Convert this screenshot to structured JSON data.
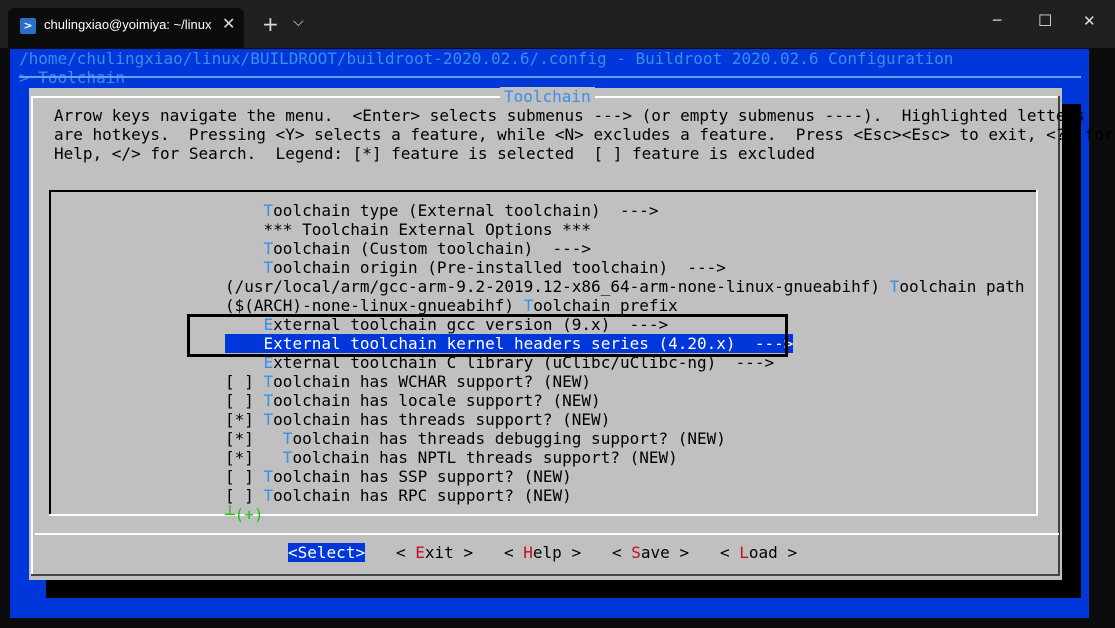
{
  "window": {
    "tab_title": "chulingxiao@yoimiya: ~/linux",
    "tab_icon": "terminal-icon",
    "new_tab": "+",
    "dropdown": "⌵",
    "minimize": "─",
    "maximize": "☐",
    "close": "✕",
    "tab_close": "✕"
  },
  "header": {
    "path": "/home/chulingxiao/linux/BUILDROOT/buildroot-2020.02.6/.config - Buildroot 2020.02.6 Configuration",
    "breadcrumb": "> Toolchain"
  },
  "dialog": {
    "title": "Toolchain",
    "help_lines": [
      "Arrow keys navigate the menu.  <Enter> selects submenus ---> (or empty submenus ----).  Highlighted letters",
      "are hotkeys.  Pressing <Y> selects a feature, while <N> excludes a feature.  Press <Esc><Esc> to exit, <?> for",
      "Help, </> for Search.  Legend: [*] feature is selected  [ ] feature is excluded"
    ]
  },
  "menu": {
    "items": [
      {
        "prefix": "    ",
        "hotkey": "T",
        "rest": "oolchain type (External toolchain)  --->"
      },
      {
        "prefix": "    ",
        "hotkey": "",
        "rest": "*** Toolchain External Options ***"
      },
      {
        "prefix": "    ",
        "hotkey": "T",
        "rest": "oolchain (Custom toolchain)  --->"
      },
      {
        "prefix": "    ",
        "hotkey": "T",
        "rest": "oolchain origin (Pre-installed toolchain)  --->"
      },
      {
        "prefix": "(/usr/local/arm/gcc-arm-9.2-2019.12-x86_64-arm-none-linux-gnueabihf) ",
        "hotkey": "T",
        "rest": "oolchain path"
      },
      {
        "prefix": "($(ARCH)-none-linux-gnueabihf) ",
        "hotkey": "T",
        "rest": "oolchain prefix"
      },
      {
        "prefix": "    ",
        "hotkey": "E",
        "rest": "xternal toolchain gcc version (9.x)  --->"
      },
      {
        "prefix": "    ",
        "hotkey": "E",
        "rest": "xternal toolchain kernel headers series (4.20.x)  --->",
        "selected": true
      },
      {
        "prefix": "    ",
        "hotkey": "E",
        "rest": "xternal toolchain C library (uClibc/uClibc-ng)  --->"
      },
      {
        "prefix": "[ ] ",
        "hotkey": "T",
        "rest": "oolchain has WCHAR support? (NEW)"
      },
      {
        "prefix": "[ ] ",
        "hotkey": "T",
        "rest": "oolchain has locale support? (NEW)"
      },
      {
        "prefix": "[*] ",
        "hotkey": "T",
        "rest": "oolchain has threads support? (NEW)"
      },
      {
        "prefix": "[*]   ",
        "hotkey": "T",
        "rest": "oolchain has threads debugging support? (NEW)"
      },
      {
        "prefix": "[*]   ",
        "hotkey": "T",
        "rest": "oolchain has NPTL threads support? (NEW)"
      },
      {
        "prefix": "[ ] ",
        "hotkey": "T",
        "rest": "oolchain has SSP support? (NEW)"
      },
      {
        "prefix": "[ ] ",
        "hotkey": "T",
        "rest": "oolchain has RPC support? (NEW)"
      }
    ],
    "more_indicator": "┴(+)"
  },
  "buttons": {
    "select": {
      "pre": "<",
      "hk": "S",
      "post": "elect>"
    },
    "exit": {
      "pre": "< ",
      "hk": "E",
      "post": "xit >"
    },
    "help": {
      "pre": "< ",
      "hk": "H",
      "post": "elp >"
    },
    "save": {
      "pre": "< ",
      "hk": "S",
      "post": "ave >"
    },
    "load": {
      "pre": "< ",
      "hk": "L",
      "post": "oad >"
    }
  }
}
